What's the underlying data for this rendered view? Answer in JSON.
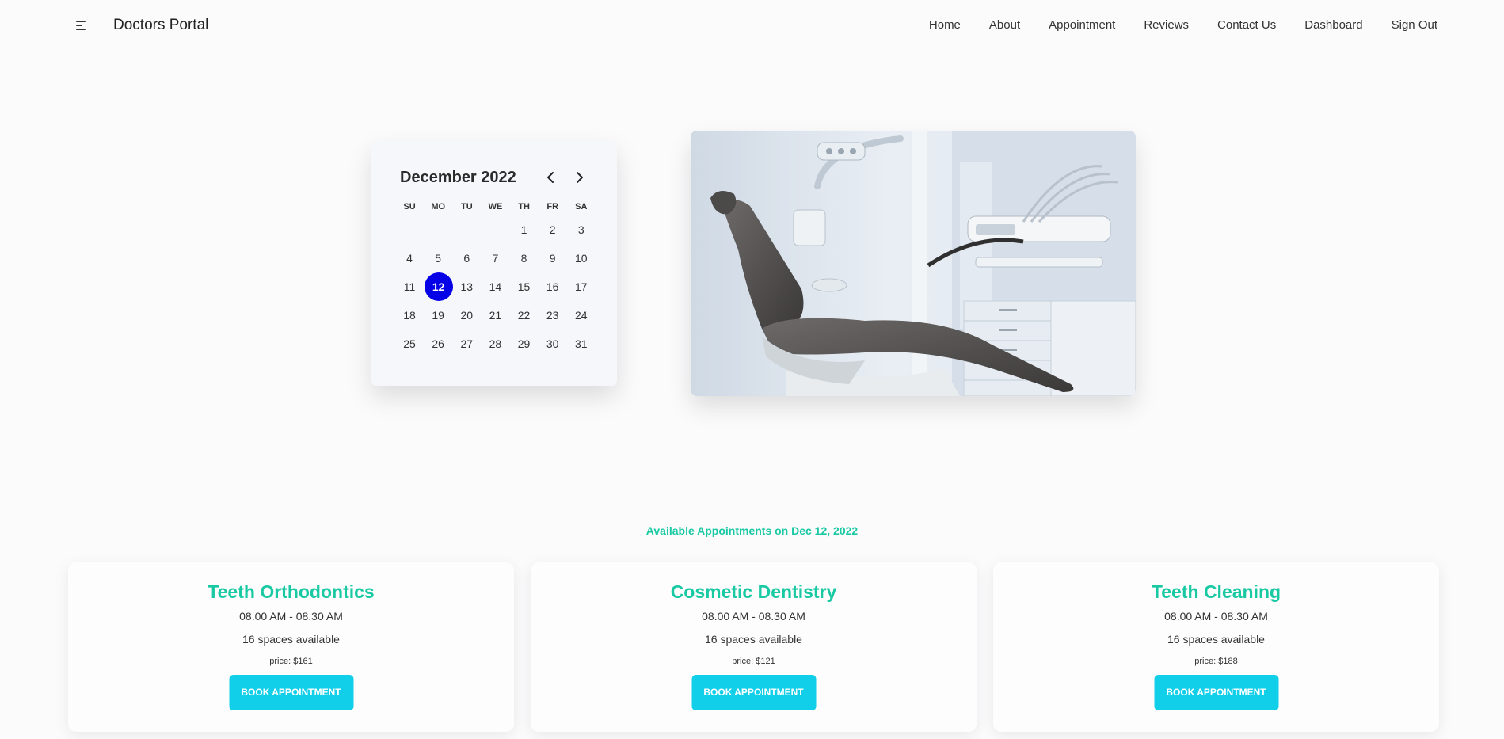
{
  "navbar": {
    "brand": "Doctors Portal",
    "links": [
      "Home",
      "About",
      "Appointment",
      "Reviews",
      "Contact Us",
      "Dashboard",
      "Sign Out"
    ]
  },
  "calendar": {
    "month_label": "December 2022",
    "weekdays": [
      "SU",
      "MO",
      "TU",
      "WE",
      "TH",
      "FR",
      "SA"
    ],
    "weeks": [
      [
        "",
        "",
        "",
        "",
        "1",
        "2",
        "3"
      ],
      [
        "4",
        "5",
        "6",
        "7",
        "8",
        "9",
        "10"
      ],
      [
        "11",
        "12",
        "13",
        "14",
        "15",
        "16",
        "17"
      ],
      [
        "18",
        "19",
        "20",
        "21",
        "22",
        "23",
        "24"
      ],
      [
        "25",
        "26",
        "27",
        "28",
        "29",
        "30",
        "31"
      ]
    ],
    "selected_day": "12",
    "selected_color": "#0600e6"
  },
  "hero": {
    "image_subject": "dental-chair-photo"
  },
  "appointments": {
    "heading": "Available Appointments on Dec 12, 2022",
    "accent_color": "#19c9a3",
    "button_color": "#11cfe9",
    "cards": [
      {
        "title": "Teeth Orthodontics",
        "time": "08.00 AM - 08.30 AM",
        "spaces": "16 spaces available",
        "price": "price: $161",
        "button": "BOOK APPOINTMENT"
      },
      {
        "title": "Cosmetic Dentistry",
        "time": "08.00 AM - 08.30 AM",
        "spaces": "16 spaces available",
        "price": "price: $121",
        "button": "BOOK APPOINTMENT"
      },
      {
        "title": "Teeth Cleaning",
        "time": "08.00 AM - 08.30 AM",
        "spaces": "16 spaces available",
        "price": "price: $188",
        "button": "BOOK APPOINTMENT"
      }
    ]
  }
}
